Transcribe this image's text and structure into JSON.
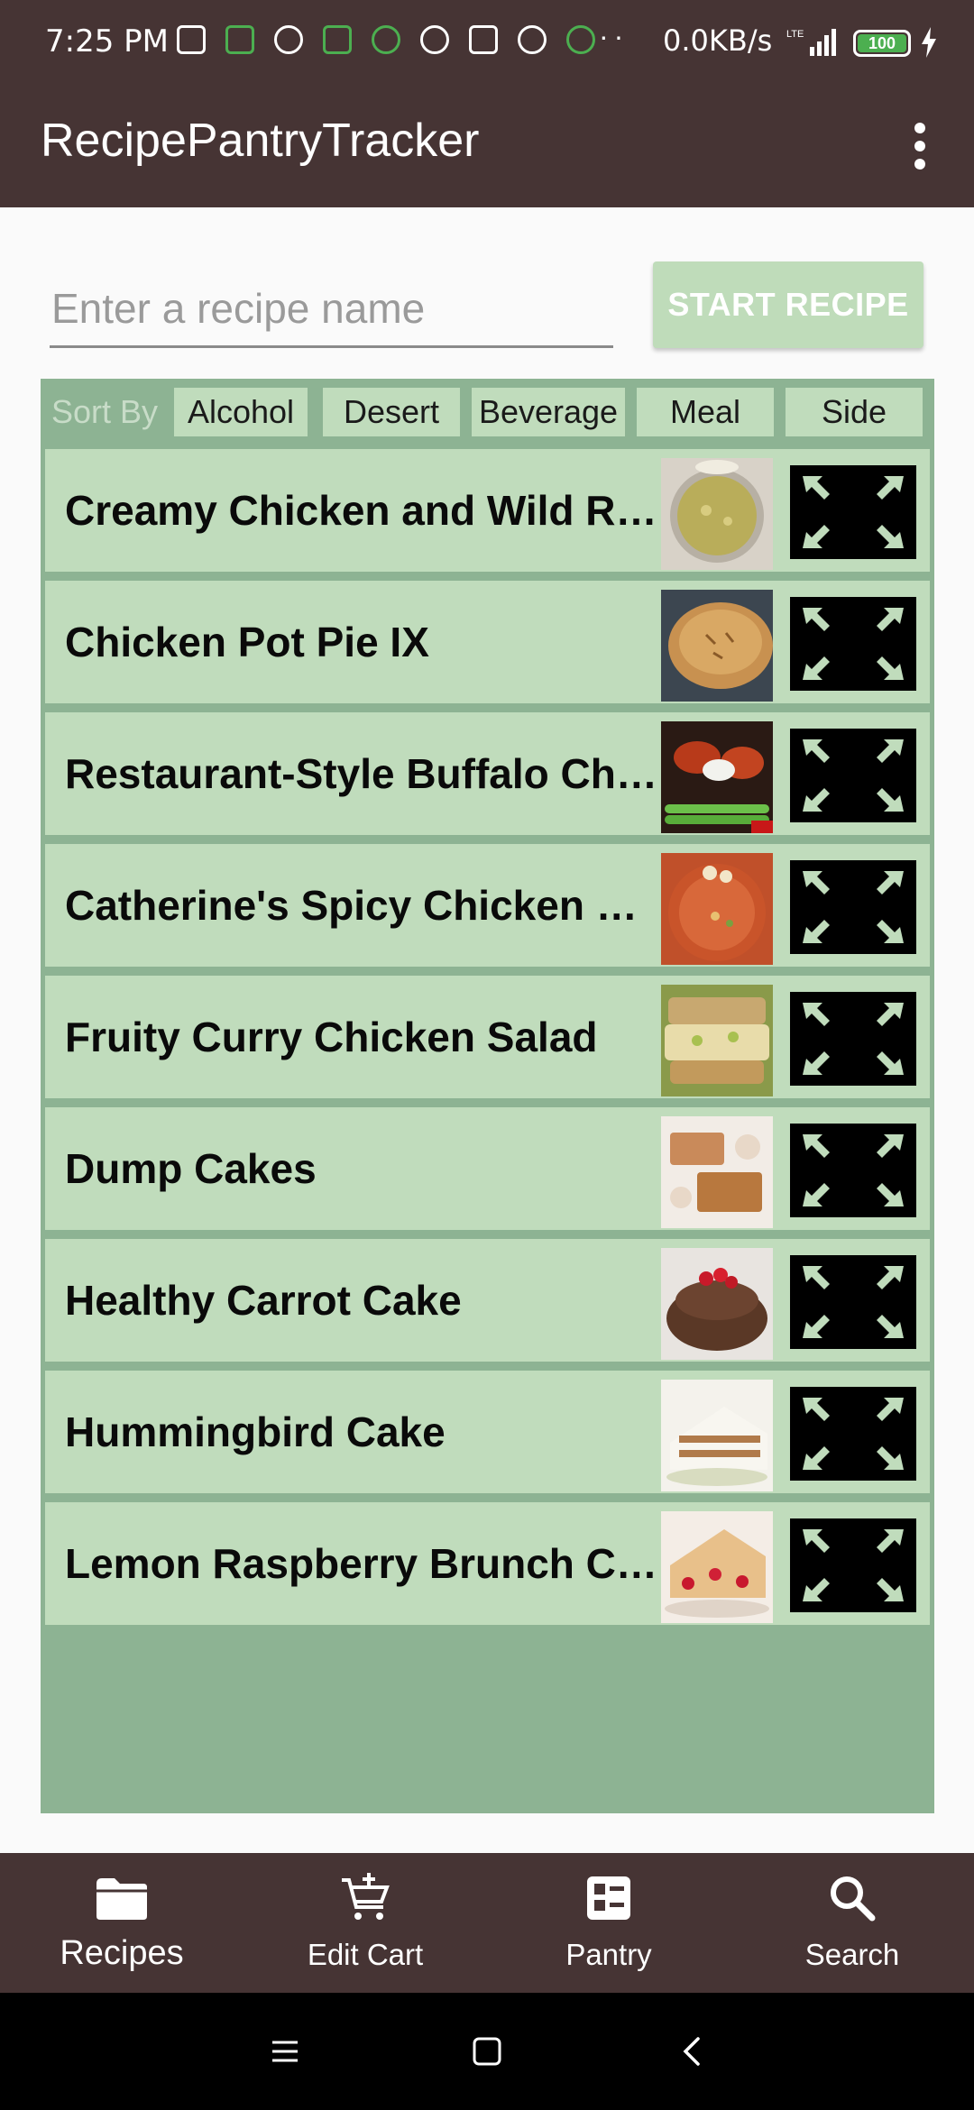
{
  "status_bar": {
    "time": "7:25 PM",
    "speed": "0.0KB/s",
    "network": "LTE",
    "battery": "100",
    "notification_icons": [
      "message-icon",
      "voicemail-app-icon",
      "speed-icon",
      "shield-app-icon",
      "usb-icon",
      "cloud-icon",
      "shield-app-icon",
      "voicemail-icon",
      "usb-icon"
    ]
  },
  "app_bar": {
    "title": "RecipePantryTracker"
  },
  "search": {
    "placeholder": "Enter a recipe name",
    "value": "",
    "start_button_label": "START RECIPE"
  },
  "sort": {
    "label": "Sort By",
    "options": [
      "Alcohol",
      "Desert",
      "Beverage",
      "Meal",
      "Side"
    ]
  },
  "recipes": [
    {
      "title": "Creamy Chicken and Wild Rice Soup",
      "thumb": "soup-bowl-image"
    },
    {
      "title": "Chicken Pot Pie IX",
      "thumb": "pot-pie-image"
    },
    {
      "title": "Restaurant-Style Buffalo Chicken Wings",
      "thumb": "buffalo-wings-image"
    },
    {
      "title": "Catherine's Spicy Chicken Chili",
      "thumb": "chili-bowl-image"
    },
    {
      "title": "Fruity Curry Chicken Salad",
      "thumb": "salad-sandwich-image"
    },
    {
      "title": "Dump Cakes",
      "thumb": "dump-cake-image"
    },
    {
      "title": "Healthy Carrot Cake",
      "thumb": "bundt-cake-image"
    },
    {
      "title": "Hummingbird Cake",
      "thumb": "layer-cake-image"
    },
    {
      "title": "Lemon Raspberry Brunch Cake",
      "thumb": "raspberry-cake-image"
    }
  ],
  "bottom_nav": [
    {
      "label": "Recipes",
      "icon": "folder-icon",
      "active": true
    },
    {
      "label": "Edit Cart",
      "icon": "add-to-cart-icon",
      "active": false
    },
    {
      "label": "Pantry",
      "icon": "pantry-list-icon",
      "active": false
    },
    {
      "label": "Search",
      "icon": "search-icon",
      "active": false
    }
  ],
  "colors": {
    "app_bar": "#463434",
    "panel": "#8db393",
    "row": "#c0dcbc",
    "accent_button": "#bfdcba"
  }
}
